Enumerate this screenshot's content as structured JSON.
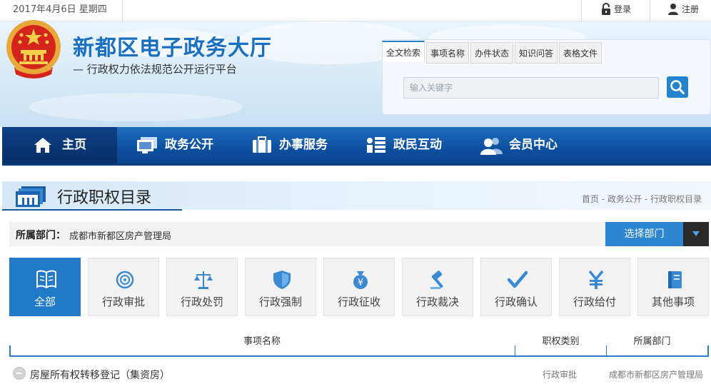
{
  "topbar": {
    "date": "2017年4月6日 星期四",
    "login": "登录",
    "register": "注册",
    "login_icon": "lock-icon",
    "register_icon": "user-icon"
  },
  "header": {
    "title": "新都区电子政务大厅",
    "subtitle": "— 行政权力依法规范公开运行平台",
    "emblem": "national-emblem"
  },
  "search": {
    "tabs": [
      {
        "label": "全文检索",
        "active": true
      },
      {
        "label": "事项名称"
      },
      {
        "label": "办件状态"
      },
      {
        "label": "知识问答"
      },
      {
        "label": "表格文件"
      }
    ],
    "placeholder": "输入关键字",
    "button_icon": "search-icon"
  },
  "nav": [
    {
      "label": "主页",
      "icon": "home-icon"
    },
    {
      "label": "政务公开",
      "icon": "monitor-icon"
    },
    {
      "label": "办事服务",
      "icon": "briefcase-icon"
    },
    {
      "label": "政民互动",
      "icon": "list-icon"
    },
    {
      "label": "会员中心",
      "icon": "users-icon"
    }
  ],
  "section": {
    "title": "行政职权目录",
    "icon": "catalog-icon",
    "breadcrumb": [
      "首页",
      "政务公开",
      "行政职权目录"
    ],
    "separator": " - "
  },
  "department": {
    "label": "所属部门：",
    "value": "成都市新都区房产管理局",
    "select_button": "选择部门"
  },
  "categories": [
    {
      "label": "全部",
      "icon": "book-icon",
      "active": true
    },
    {
      "label": "行政审批",
      "icon": "seal-icon"
    },
    {
      "label": "行政处罚",
      "icon": "scales-icon"
    },
    {
      "label": "行政强制",
      "icon": "shield-icon"
    },
    {
      "label": "行政征收",
      "icon": "money-bag-icon"
    },
    {
      "label": "行政裁决",
      "icon": "gavel-icon"
    },
    {
      "label": "行政确认",
      "icon": "checkmark-icon"
    },
    {
      "label": "行政给付",
      "icon": "yen-icon"
    },
    {
      "label": "其他事项",
      "icon": "notebook-icon"
    }
  ],
  "table": {
    "headers": [
      "事项名称",
      "职权类别",
      "所属部门"
    ],
    "rows": [
      {
        "name": "房屋所有权转移登记（集资房）",
        "type": "行政审批",
        "dept": "成都市新都区房产管理局"
      }
    ]
  },
  "colors": {
    "accent": "#2179c7",
    "nav": "#0d4f9f",
    "title": "#1a6fc0"
  }
}
